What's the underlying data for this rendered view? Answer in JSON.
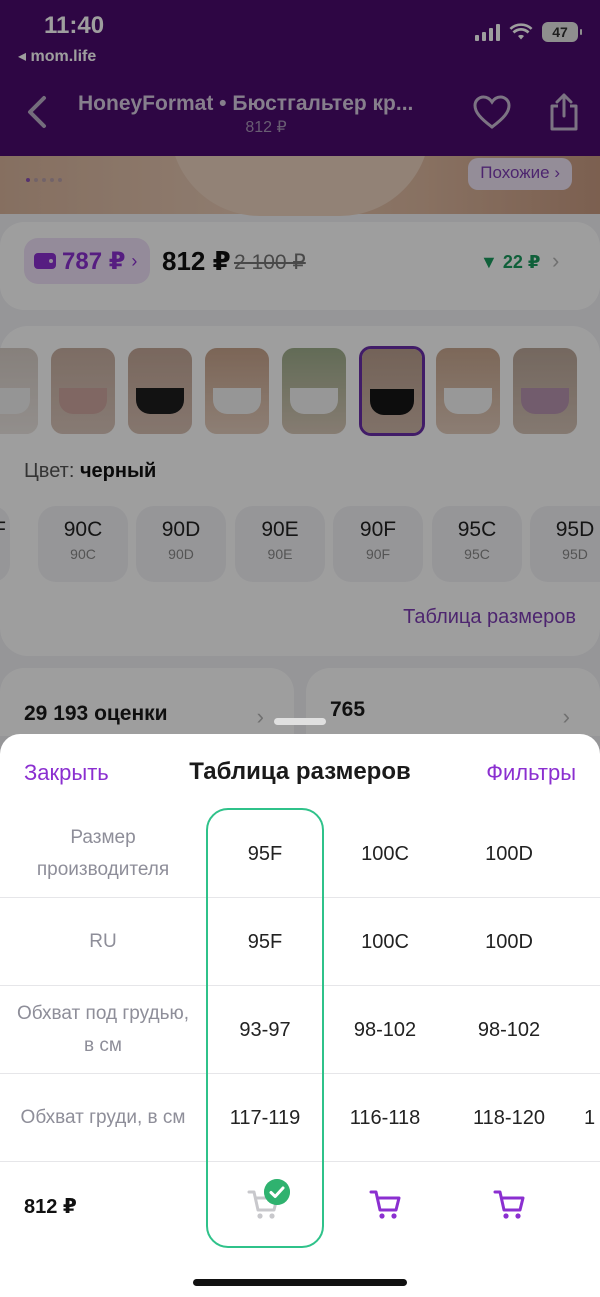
{
  "status": {
    "time": "11:40",
    "back_app": "◂ mom.life",
    "battery": "47"
  },
  "header": {
    "title": "HoneyFormat • Бюстгальтер кр...",
    "price": "812 ₽"
  },
  "product": {
    "similar_label": "Похожие ›",
    "wallet_price": "787 ₽",
    "wallet_chevron": "›",
    "price": "812 ₽",
    "old_price": "2 100 ₽",
    "drop": "▼ 22 ₽",
    "color_label": "Цвет:",
    "color_value": "черный",
    "sizes": [
      {
        "top": "F",
        "bottom": ""
      },
      {
        "top": "90C",
        "bottom": "90C"
      },
      {
        "top": "90D",
        "bottom": "90D"
      },
      {
        "top": "90E",
        "bottom": "90E"
      },
      {
        "top": "90F",
        "bottom": "90F"
      },
      {
        "top": "95C",
        "bottom": "95C"
      },
      {
        "top": "95D",
        "bottom": "95D"
      }
    ],
    "size_table_link": "Таблица размеров",
    "ratings": "29 193 оценки",
    "reviews": "765"
  },
  "sheet": {
    "close": "Закрыть",
    "title": "Таблица размеров",
    "filters": "Фильтры",
    "rows": [
      {
        "label": "Размер производителя",
        "c1": "95F",
        "c2": "100C",
        "c3": "100D",
        "c4": ""
      },
      {
        "label": "RU",
        "c1": "95F",
        "c2": "100C",
        "c3": "100D",
        "c4": ""
      },
      {
        "label": "Обхват под грудью, в см",
        "c1": "93-97",
        "c2": "98-102",
        "c3": "98-102",
        "c4": ""
      },
      {
        "label": "Обхват груди, в см",
        "c1": "117-119",
        "c2": "116-118",
        "c3": "118-120",
        "c4": "1"
      }
    ],
    "price_label": "812 ₽",
    "selected_column": "95F"
  },
  "colors": {
    "accent": "#8b2fd0",
    "header_bg": "#4b0a6e",
    "selected_border": "#2fc28a",
    "check": "#2fb26f"
  }
}
